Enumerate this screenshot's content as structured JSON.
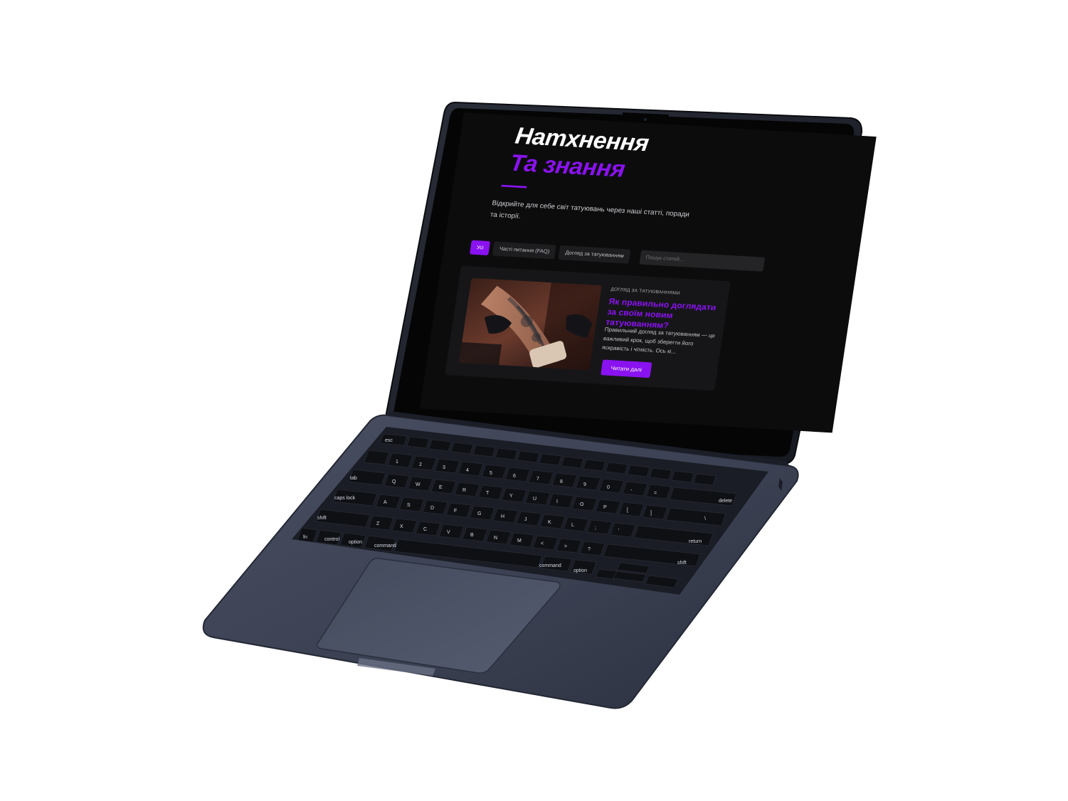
{
  "hero": {
    "title": "Натхнення",
    "title_accent": "Та знання",
    "description": "Відкрийте для себе світ татуювань через наші статті, поради та історії."
  },
  "filters": {
    "items": [
      {
        "label": "Усі",
        "active": true
      },
      {
        "label": "Часті питання (FAQ)",
        "active": false
      },
      {
        "label": "Догляд за татуюванням",
        "active": false
      }
    ],
    "search_placeholder": "Пошук статей..."
  },
  "article": {
    "category": "Догляд за татуюваннями",
    "title": "Як правильно доглядати за своїм новим татуюванням?",
    "excerpt": "Правильний догляд за татуюванням — це важливий крок, щоб зберегти його яскравість і чіткість. Ось кі...",
    "button_label": "Читати далі",
    "image_icon": "tattoo-photo"
  },
  "keyboard": {
    "labels": {
      "esc": "esc",
      "tab": "tab",
      "caps": "caps lock",
      "shift": "shift",
      "fn": "fn",
      "control": "control",
      "option": "option",
      "command": "command",
      "delete": "delete",
      "return": "return",
      "shift_r": "shift",
      "command_r": "command",
      "option_r": "option"
    },
    "row_number": [
      "`",
      "1",
      "2",
      "3",
      "4",
      "5",
      "6",
      "7",
      "8",
      "9",
      "0",
      "-",
      "="
    ],
    "row_q": [
      "Q",
      "W",
      "E",
      "R",
      "T",
      "Y",
      "U",
      "I",
      "O",
      "P",
      "[",
      "]",
      "\\"
    ],
    "row_a": [
      "A",
      "S",
      "D",
      "F",
      "G",
      "H",
      "J",
      "K",
      "L",
      ";",
      "'"
    ],
    "row_z": [
      "Z",
      "X",
      "C",
      "V",
      "B",
      "N",
      "M",
      "<",
      ">",
      "?"
    ]
  },
  "colors": {
    "accent": "#8a12f0",
    "screen_bg": "#0c0c0d",
    "laptop_body": "#3b4152",
    "keys": "#111216"
  }
}
